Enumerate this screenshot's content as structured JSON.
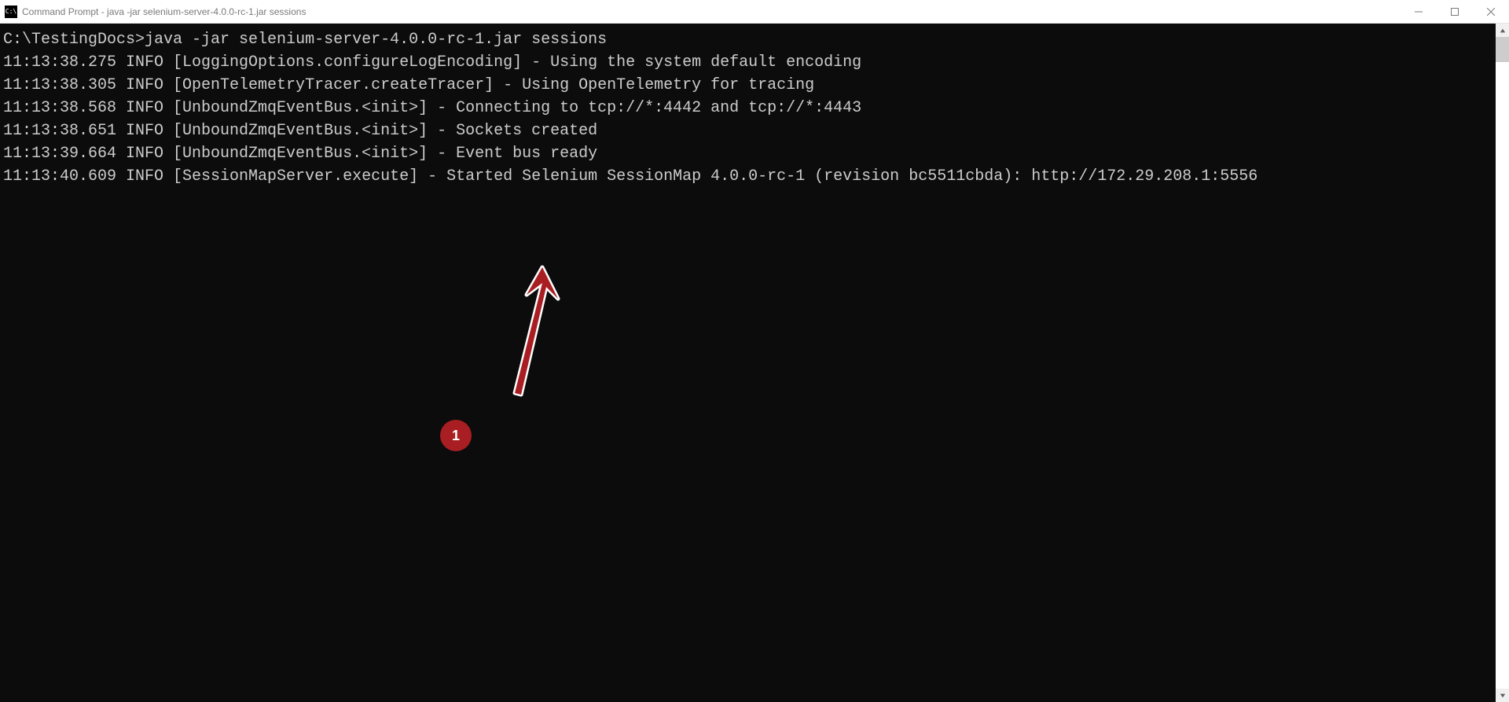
{
  "titlebar": {
    "icon_text": "C:\\",
    "title": "Command Prompt - java  -jar selenium-server-4.0.0-rc-1.jar sessions"
  },
  "window_controls": {
    "minimize": "minimize",
    "maximize": "maximize",
    "close": "close"
  },
  "terminal": {
    "prompt_path": "C:\\TestingDocs>",
    "command": "java -jar selenium-server-4.0.0-rc-1.jar sessions",
    "lines": [
      "11:13:38.275 INFO [LoggingOptions.configureLogEncoding] - Using the system default encoding",
      "11:13:38.305 INFO [OpenTelemetryTracer.createTracer] - Using OpenTelemetry for tracing",
      "11:13:38.568 INFO [UnboundZmqEventBus.<init>] - Connecting to tcp://*:4442 and tcp://*:4443",
      "11:13:38.651 INFO [UnboundZmqEventBus.<init>] - Sockets created",
      "11:13:39.664 INFO [UnboundZmqEventBus.<init>] - Event bus ready",
      "11:13:40.609 INFO [SessionMapServer.execute] - Started Selenium SessionMap 4.0.0-rc-1 (revision bc5511cbda): http://172.29.208.1:5556"
    ]
  },
  "annotation": {
    "badge_number": "1"
  }
}
